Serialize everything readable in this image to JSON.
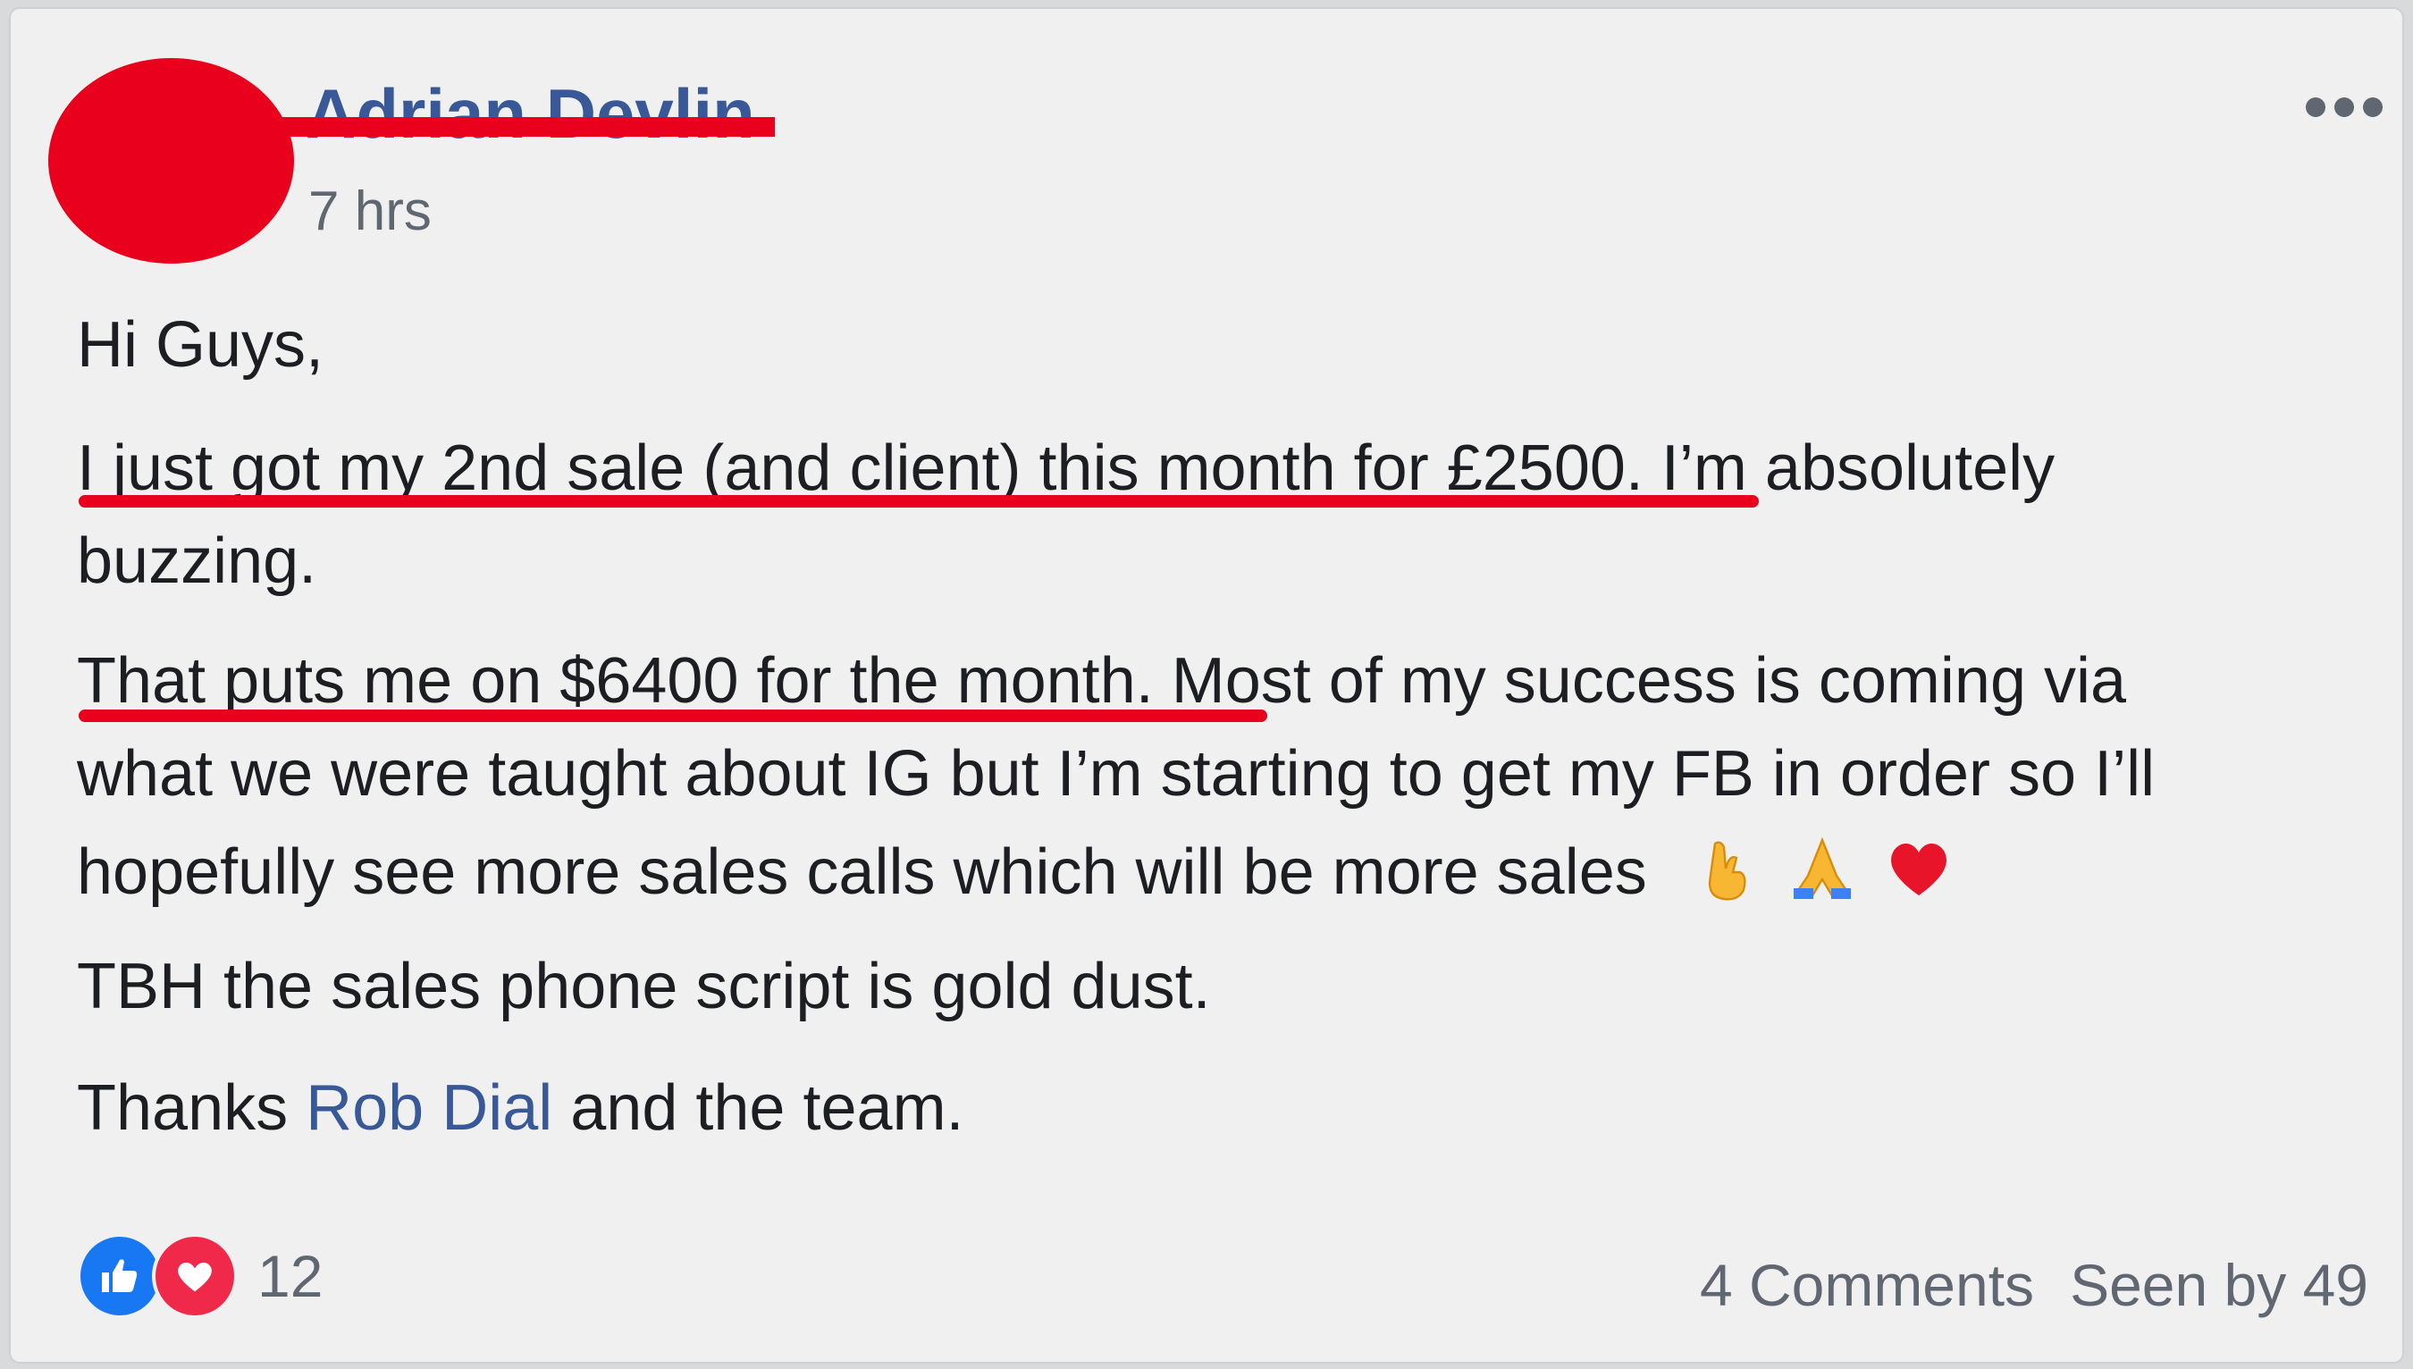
{
  "post": {
    "author": "Adrian Devlin",
    "timestamp": "7 hrs",
    "more_menu": "more-options-icon",
    "paragraphs": {
      "p1": "Hi Guys,",
      "p2_line1_underlined": "I just got my 2nd sale (and client) this month for £2500",
      "p2_line1_rest": ". I’m absolutely",
      "p2_line2": "buzzing.",
      "p3_line1_underlined": "That puts me on $6400 for the month",
      "p3_line1_rest": ". Most of my success is coming via",
      "p3_line2": "what we were taught about IG but I’m starting to get my FB in order so I’ll",
      "p3_line3": "hopefully see more sales calls which will be more sales",
      "p3_emojis": [
        "crossed-fingers-icon",
        "folded-hands-icon",
        "red-heart-icon"
      ],
      "p4": "TBH the sales phone script is gold dust.",
      "p5_before": "Thanks ",
      "p5_mention": "Rob Dial",
      "p5_after": " and the team."
    },
    "footer": {
      "reaction_icons": [
        "like-icon",
        "love-icon"
      ],
      "reaction_count": "12",
      "comments": "4 Comments",
      "seen_by": "Seen by 49"
    },
    "colors": {
      "redaction": "#e8001c",
      "link": "#385898",
      "like": "#1877f2",
      "love": "#f02849"
    }
  }
}
